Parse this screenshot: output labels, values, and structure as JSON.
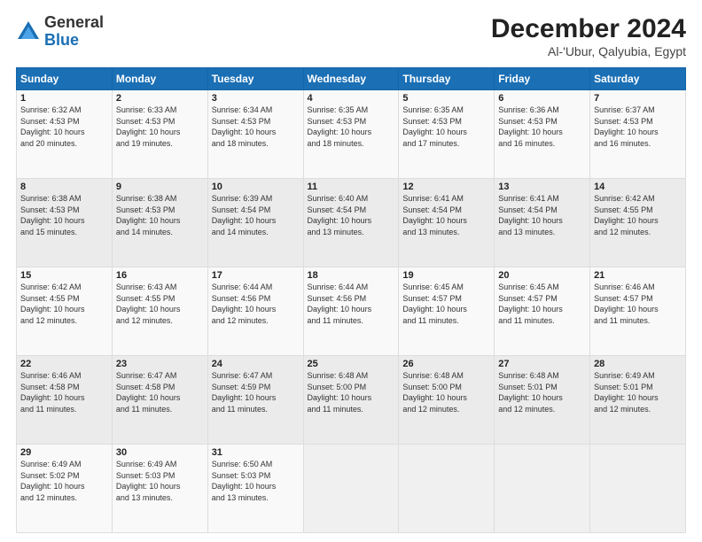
{
  "header": {
    "logo_general": "General",
    "logo_blue": "Blue",
    "title": "December 2024",
    "subtitle": "Al-'Ubur, Qalyubia, Egypt"
  },
  "days_of_week": [
    "Sunday",
    "Monday",
    "Tuesday",
    "Wednesday",
    "Thursday",
    "Friday",
    "Saturday"
  ],
  "weeks": [
    [
      {
        "day": "1",
        "info": "Sunrise: 6:32 AM\nSunset: 4:53 PM\nDaylight: 10 hours\nand 20 minutes."
      },
      {
        "day": "2",
        "info": "Sunrise: 6:33 AM\nSunset: 4:53 PM\nDaylight: 10 hours\nand 19 minutes."
      },
      {
        "day": "3",
        "info": "Sunrise: 6:34 AM\nSunset: 4:53 PM\nDaylight: 10 hours\nand 18 minutes."
      },
      {
        "day": "4",
        "info": "Sunrise: 6:35 AM\nSunset: 4:53 PM\nDaylight: 10 hours\nand 18 minutes."
      },
      {
        "day": "5",
        "info": "Sunrise: 6:35 AM\nSunset: 4:53 PM\nDaylight: 10 hours\nand 17 minutes."
      },
      {
        "day": "6",
        "info": "Sunrise: 6:36 AM\nSunset: 4:53 PM\nDaylight: 10 hours\nand 16 minutes."
      },
      {
        "day": "7",
        "info": "Sunrise: 6:37 AM\nSunset: 4:53 PM\nDaylight: 10 hours\nand 16 minutes."
      }
    ],
    [
      {
        "day": "8",
        "info": "Sunrise: 6:38 AM\nSunset: 4:53 PM\nDaylight: 10 hours\nand 15 minutes."
      },
      {
        "day": "9",
        "info": "Sunrise: 6:38 AM\nSunset: 4:53 PM\nDaylight: 10 hours\nand 14 minutes."
      },
      {
        "day": "10",
        "info": "Sunrise: 6:39 AM\nSunset: 4:54 PM\nDaylight: 10 hours\nand 14 minutes."
      },
      {
        "day": "11",
        "info": "Sunrise: 6:40 AM\nSunset: 4:54 PM\nDaylight: 10 hours\nand 13 minutes."
      },
      {
        "day": "12",
        "info": "Sunrise: 6:41 AM\nSunset: 4:54 PM\nDaylight: 10 hours\nand 13 minutes."
      },
      {
        "day": "13",
        "info": "Sunrise: 6:41 AM\nSunset: 4:54 PM\nDaylight: 10 hours\nand 13 minutes."
      },
      {
        "day": "14",
        "info": "Sunrise: 6:42 AM\nSunset: 4:55 PM\nDaylight: 10 hours\nand 12 minutes."
      }
    ],
    [
      {
        "day": "15",
        "info": "Sunrise: 6:42 AM\nSunset: 4:55 PM\nDaylight: 10 hours\nand 12 minutes."
      },
      {
        "day": "16",
        "info": "Sunrise: 6:43 AM\nSunset: 4:55 PM\nDaylight: 10 hours\nand 12 minutes."
      },
      {
        "day": "17",
        "info": "Sunrise: 6:44 AM\nSunset: 4:56 PM\nDaylight: 10 hours\nand 12 minutes."
      },
      {
        "day": "18",
        "info": "Sunrise: 6:44 AM\nSunset: 4:56 PM\nDaylight: 10 hours\nand 11 minutes."
      },
      {
        "day": "19",
        "info": "Sunrise: 6:45 AM\nSunset: 4:57 PM\nDaylight: 10 hours\nand 11 minutes."
      },
      {
        "day": "20",
        "info": "Sunrise: 6:45 AM\nSunset: 4:57 PM\nDaylight: 10 hours\nand 11 minutes."
      },
      {
        "day": "21",
        "info": "Sunrise: 6:46 AM\nSunset: 4:57 PM\nDaylight: 10 hours\nand 11 minutes."
      }
    ],
    [
      {
        "day": "22",
        "info": "Sunrise: 6:46 AM\nSunset: 4:58 PM\nDaylight: 10 hours\nand 11 minutes."
      },
      {
        "day": "23",
        "info": "Sunrise: 6:47 AM\nSunset: 4:58 PM\nDaylight: 10 hours\nand 11 minutes."
      },
      {
        "day": "24",
        "info": "Sunrise: 6:47 AM\nSunset: 4:59 PM\nDaylight: 10 hours\nand 11 minutes."
      },
      {
        "day": "25",
        "info": "Sunrise: 6:48 AM\nSunset: 5:00 PM\nDaylight: 10 hours\nand 11 minutes."
      },
      {
        "day": "26",
        "info": "Sunrise: 6:48 AM\nSunset: 5:00 PM\nDaylight: 10 hours\nand 12 minutes."
      },
      {
        "day": "27",
        "info": "Sunrise: 6:48 AM\nSunset: 5:01 PM\nDaylight: 10 hours\nand 12 minutes."
      },
      {
        "day": "28",
        "info": "Sunrise: 6:49 AM\nSunset: 5:01 PM\nDaylight: 10 hours\nand 12 minutes."
      }
    ],
    [
      {
        "day": "29",
        "info": "Sunrise: 6:49 AM\nSunset: 5:02 PM\nDaylight: 10 hours\nand 12 minutes."
      },
      {
        "day": "30",
        "info": "Sunrise: 6:49 AM\nSunset: 5:03 PM\nDaylight: 10 hours\nand 13 minutes."
      },
      {
        "day": "31",
        "info": "Sunrise: 6:50 AM\nSunset: 5:03 PM\nDaylight: 10 hours\nand 13 minutes."
      },
      {
        "day": "",
        "info": ""
      },
      {
        "day": "",
        "info": ""
      },
      {
        "day": "",
        "info": ""
      },
      {
        "day": "",
        "info": ""
      }
    ]
  ]
}
